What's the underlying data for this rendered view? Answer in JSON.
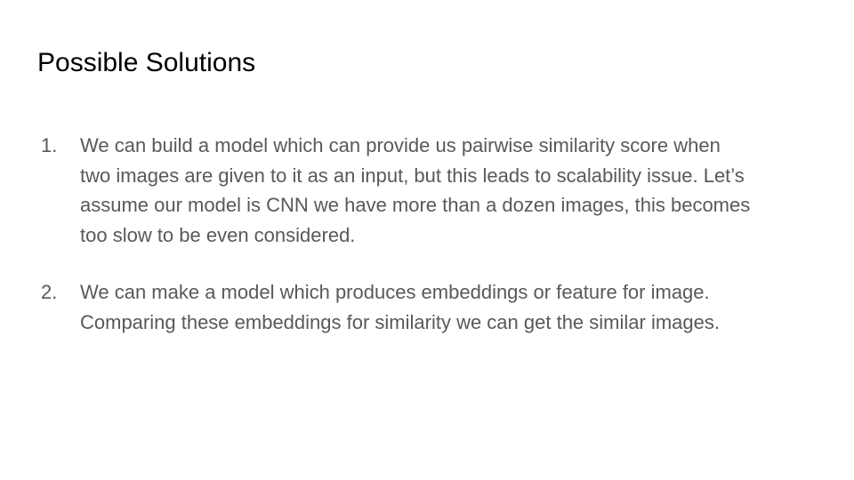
{
  "slide": {
    "title": "Possible Solutions",
    "items": [
      {
        "number": "1.",
        "lines": [
          "We can build a model which can provide us pairwise similarity score when",
          "two images are given to it as an input, but this leads to scalability issue. Let’s",
          "assume our model is CNN we have more than a dozen images, this becomes",
          "too slow to be even considered."
        ]
      },
      {
        "number": "2.",
        "lines": [
          "We can make a model which produces embeddings or feature for image.",
          "Comparing these embeddings for similarity we can get the similar images."
        ]
      }
    ]
  },
  "colors": {
    "title": "#000000",
    "body": "#595959",
    "background": "#ffffff"
  }
}
